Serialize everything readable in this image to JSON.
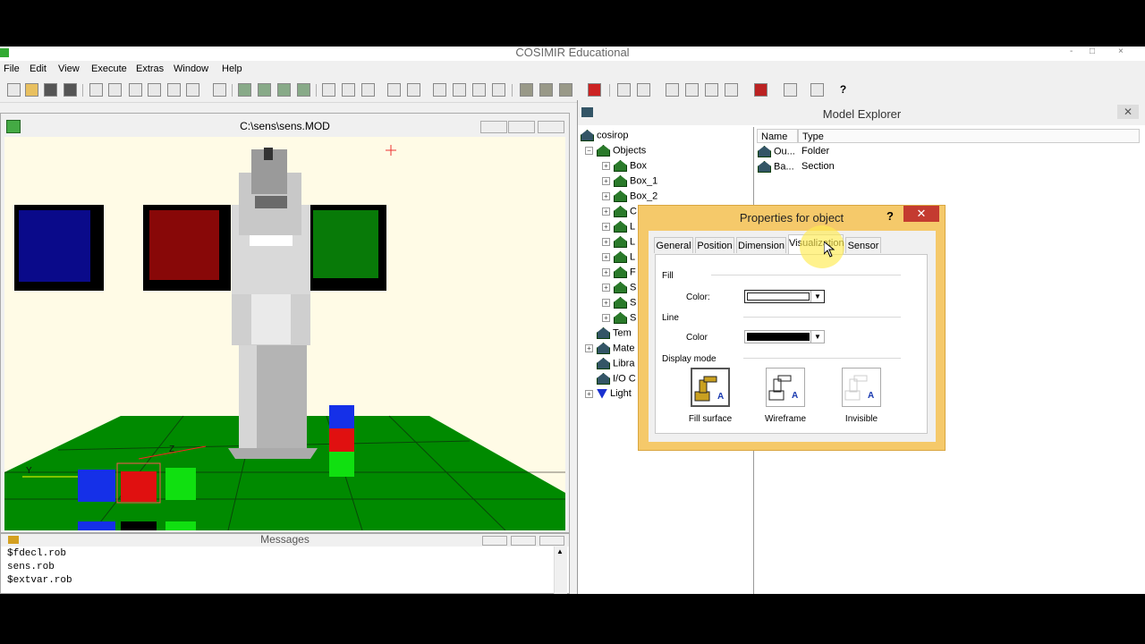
{
  "app": {
    "title": "COSIMIR Educational",
    "window_controls": [
      "-",
      "□",
      "×"
    ]
  },
  "menu": [
    "File",
    "Edit",
    "View",
    "Execute",
    "Extras",
    "Window",
    "Help"
  ],
  "view_window": {
    "title": "C:\\sens\\sens.MOD",
    "axis_labels": {
      "z": "Z",
      "y": "Y"
    }
  },
  "messages": {
    "title": "Messages",
    "lines": [
      "$fdecl.rob",
      "sens.rob",
      "$extvar.rob"
    ]
  },
  "explorer": {
    "title": "Model Explorer",
    "tree": {
      "root": "cosirop",
      "objects_label": "Objects",
      "items": [
        "Box",
        "Box_1",
        "Box_2"
      ],
      "partial_items": [
        "C",
        "L",
        "L",
        "L",
        "F",
        "S",
        "S",
        "S"
      ],
      "bottom_items": [
        "Tem",
        "Mate",
        "Libra",
        "I/O C",
        "Light"
      ]
    },
    "list": {
      "columns": [
        "Name",
        "Type"
      ],
      "rows": [
        {
          "name": "Ou...",
          "type": "Folder"
        },
        {
          "name": "Ba...",
          "type": "Section"
        }
      ]
    }
  },
  "dialog": {
    "title": "Properties for object",
    "help": "?",
    "close": "✕",
    "tabs": [
      "General",
      "Position",
      "Dimension",
      "Visualization",
      "Sensor"
    ],
    "active_tab": "Visualization",
    "fill_group": "Fill",
    "fill_color_label": "Color:",
    "fill_color": "#ffffff",
    "line_group": "Line",
    "line_color_label": "Color",
    "line_color": "#000000",
    "display_mode_group": "Display mode",
    "modes": [
      "Fill surface",
      "Wireframe",
      "Invisible"
    ],
    "active_mode": "Fill surface"
  }
}
